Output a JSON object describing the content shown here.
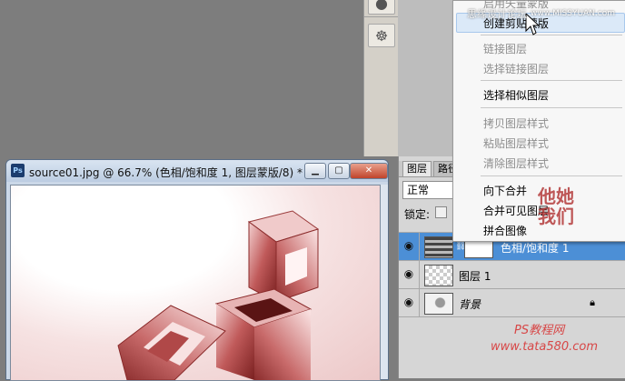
{
  "context_menu": {
    "items": [
      {
        "label": "启用矢量蒙版",
        "disabled": true
      },
      {
        "label": "创建剪贴蒙版",
        "disabled": false,
        "highlighted": true
      },
      {
        "label": "链接图层",
        "disabled": true
      },
      {
        "label": "选择链接图层",
        "disabled": true
      },
      {
        "label": "选择相似图层",
        "disabled": false
      },
      {
        "label": "拷贝图层样式",
        "disabled": true
      },
      {
        "label": "粘贴图层样式",
        "disabled": true
      },
      {
        "label": "清除图层样式",
        "disabled": true
      },
      {
        "label": "向下合并",
        "disabled": false
      },
      {
        "label": "合并可见图层",
        "disabled": false
      },
      {
        "label": "拼合图像",
        "disabled": false
      }
    ]
  },
  "layers_panel": {
    "tabs": [
      "图层",
      "路径"
    ],
    "blend_mode": "正常",
    "lock_label": "锁定:",
    "layers": [
      {
        "name": "色相/饱和度 1",
        "selected": true,
        "thumb": "adjustment"
      },
      {
        "name": "图层 1",
        "selected": false,
        "thumb": "transparent"
      },
      {
        "name": "背景",
        "selected": false,
        "thumb": "background",
        "locked": true
      }
    ]
  },
  "document": {
    "app_icon": "Ps",
    "title": "source01.jpg @ 66.7% (色相/饱和度 1, 图层蒙版/8) *",
    "buttons": [
      "minimize",
      "maximize",
      "close"
    ]
  },
  "watermarks": {
    "top_site": "思缘设计论坛",
    "top_url": "www.MISSYUAN.com",
    "bottom_brand": "PS教程网",
    "bottom_url": "www.tata580.com",
    "calligraphy": "他她我们"
  },
  "icons": {
    "tool": "ship-wheel-icon",
    "eye": "eye-icon",
    "lock": "lock-icon",
    "cursor": "arrow-cursor-icon"
  },
  "colors": {
    "selection": "#4c8fd6",
    "menu_highlight": "#dbe9f8",
    "image_tint": "#c06060"
  }
}
